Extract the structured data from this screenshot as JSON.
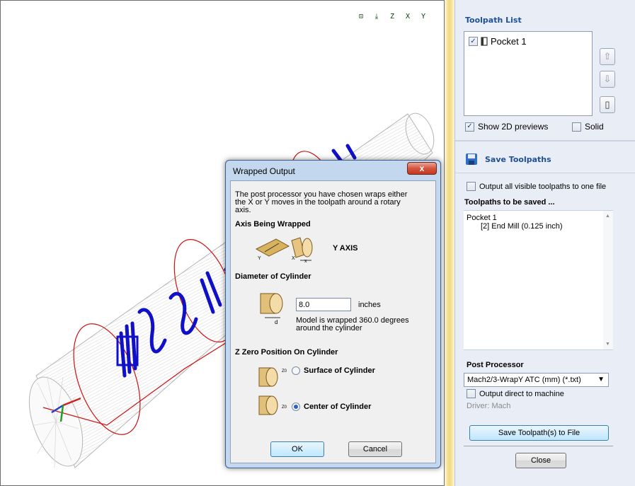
{
  "viewport": {
    "toolbar": [
      {
        "name": "view-fit-icon",
        "glyph": "⊡"
      },
      {
        "name": "view-iso-icon",
        "glyph": "⤓"
      },
      {
        "name": "view-top-z-icon",
        "glyph": "Z"
      },
      {
        "name": "view-front-x-icon",
        "glyph": "X"
      },
      {
        "name": "view-side-y-icon",
        "glyph": "Y"
      }
    ]
  },
  "panel": {
    "toolpath_list_title": "Toolpath List",
    "toolpaths": [
      {
        "name": "Pocket 1",
        "checked": true
      }
    ],
    "show_2d_previews_label": "Show 2D previews",
    "show_2d_previews_checked": true,
    "solid_label": "Solid",
    "solid_checked": false,
    "save_toolpaths_title": "Save Toolpaths",
    "output_all_label": "Output all visible toolpaths to one file",
    "to_be_saved_title": "Toolpaths to be saved ...",
    "saved_items": [
      "Pocket 1",
      "[2] End Mill (0.125 inch)"
    ],
    "post_processor_title": "Post Processor",
    "post_processor_value": "Mach2/3-WrapY ATC (mm) (*.txt)",
    "output_direct_label": "Output direct to machine",
    "driver_label": "Driver: Mach",
    "save_button": "Save Toolpath(s) to File",
    "close_button": "Close"
  },
  "dialog": {
    "title": "Wrapped Output",
    "close_glyph": "x",
    "description_lines": [
      "The post processor you have chosen wraps either",
      "the X or Y moves in the toolpath around a rotary",
      "axis."
    ],
    "axis_heading": "Axis Being Wrapped",
    "axis_value": "Y AXIS",
    "axis_icon_y_label": "Y",
    "axis_icon_x_label": "X",
    "axis_icon_x2_label": "x",
    "diameter_heading": "Diameter of Cylinder",
    "diameter_value": "8.0",
    "diameter_unit": "inches",
    "diameter_icon_label": "d",
    "wrap_note_lines": [
      "Model is wrapped 360.0 degrees",
      "around the cylinder"
    ],
    "z_zero_heading": "Z Zero Position On Cylinder",
    "z0_label": "Z0",
    "surface_option": "Surface of Cylinder",
    "center_option": "Center of Cylinder",
    "selected_option": "center",
    "ok_button": "OK",
    "cancel_button": "Cancel"
  },
  "colors": {
    "accent_blue": "#1f4e96",
    "toolpath_blue": "#1010c8",
    "boundary_red": "#cc1111",
    "wire_gray": "#b5b5b5"
  }
}
